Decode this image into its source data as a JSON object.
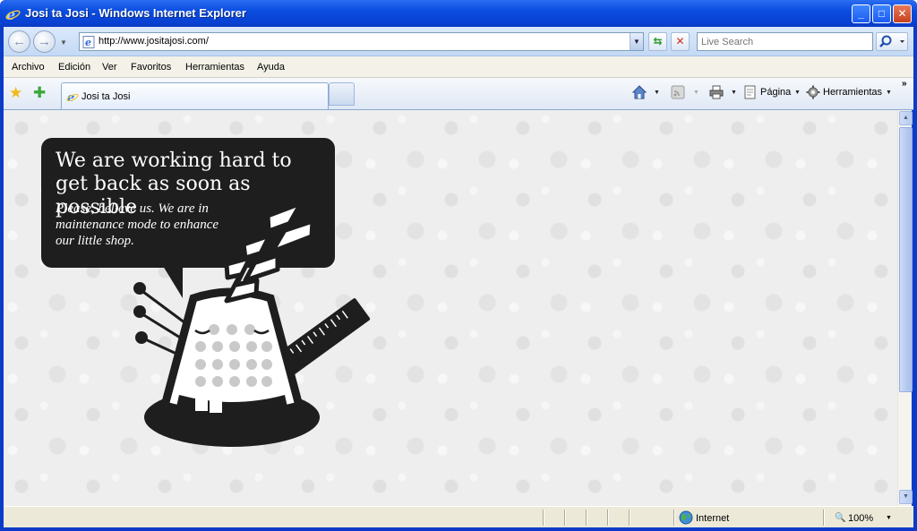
{
  "window": {
    "title": "Josi ta Josi - Windows Internet Explorer",
    "minimize": "_",
    "maximize": "□",
    "close": "✕"
  },
  "address": {
    "url": "http://www.jositajosi.com/",
    "search_placeholder": "Live Search"
  },
  "menu": {
    "items": [
      "Archivo",
      "Edición",
      "Ver",
      "Favoritos",
      "Herramientas",
      "Ayuda"
    ]
  },
  "tabs": {
    "active_label": "Josi ta Josi"
  },
  "commandbar": {
    "page_label": "Página",
    "tools_label": "Herramientas"
  },
  "page": {
    "heading": "We are working hard to get back as soon as possible",
    "subtext": "Please, believe us. We are in maintenance mode to enhance our little shop."
  },
  "status": {
    "zone": "Internet",
    "zoom": "100%"
  },
  "colors": {
    "titlebar": "#0a4ed8",
    "bubble": "#1e1e1e"
  }
}
